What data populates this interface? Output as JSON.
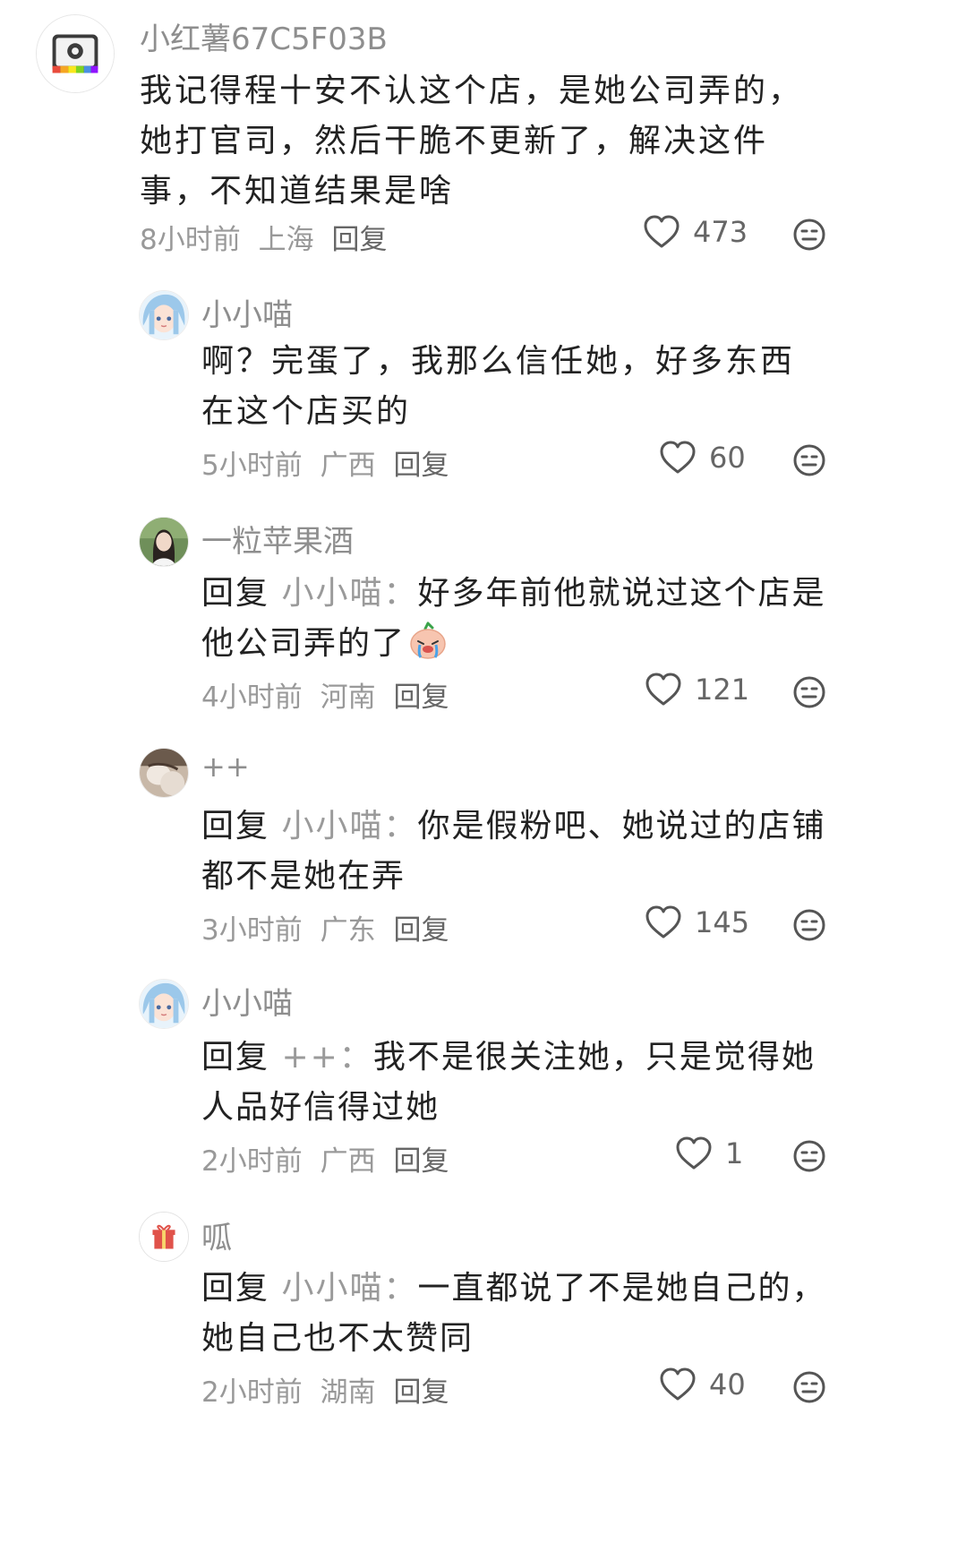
{
  "comments": [
    {
      "username": "小红薯67C5F03B",
      "avatar": "camera-icon",
      "text": "我记得程十安不认这个店，是她公司弄的，她打官司，然后干脆不更新了，解决这件事，不知道结果是啥",
      "time": "8小时前",
      "location": "上海",
      "reply_label": "回复",
      "likes": "473"
    }
  ],
  "replies": [
    {
      "username": "小小喵",
      "avatar": "anime-girl-avatar",
      "text": "啊？完蛋了，我那么信任她，好多东西在这个店买的",
      "time": "5小时前",
      "location": "广西",
      "reply_label": "回复",
      "likes": "60"
    },
    {
      "username": "一粒苹果酒",
      "avatar": "girl-photo-avatar",
      "prefix": "回复",
      "target": "小小喵：",
      "text": "好多年前他就说过这个店是他公司弄的了",
      "emoji": "crying-face-emoji",
      "time": "4小时前",
      "location": "河南",
      "reply_label": "回复",
      "likes": "121"
    },
    {
      "username": "++",
      "avatar": "photo-avatar",
      "prefix": "回复",
      "target": "小小喵：",
      "text": "你是假粉吧、她说过的店铺都不是她在弄",
      "time": "3小时前",
      "location": "广东",
      "reply_label": "回复",
      "likes": "145"
    },
    {
      "username": "小小喵",
      "avatar": "anime-girl-avatar",
      "prefix": "回复",
      "target": "++：",
      "text": "我不是很关注她，只是觉得她人品好信得过她",
      "time": "2小时前",
      "location": "广西",
      "reply_label": "回复",
      "likes": "1"
    },
    {
      "username": "呱",
      "avatar": "gift-icon",
      "prefix": "回复",
      "target": "小小喵：",
      "text": "一直都说了不是她自己的，她自己也不太赞同",
      "time": "2小时前",
      "location": "湖南",
      "reply_label": "回复",
      "likes": "40"
    }
  ],
  "colors": {
    "text": "#222222",
    "username": "#8e8e8e",
    "meta": "#999999",
    "icon": "#555555"
  }
}
